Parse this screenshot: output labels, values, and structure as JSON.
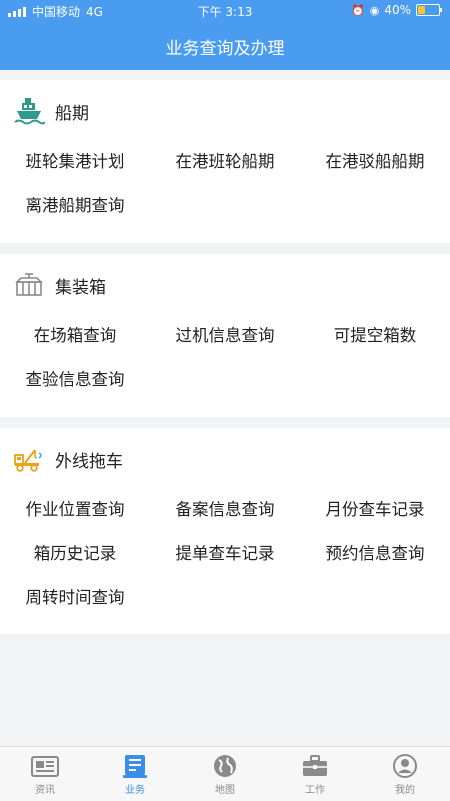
{
  "status_bar": {
    "carrier": "中国移动",
    "network": "4G",
    "time": "下午 3:13",
    "battery_text": "40%",
    "battery_level": 0.4,
    "battery_color": "#f7c43b"
  },
  "header": {
    "title": "业务查询及办理",
    "background": "#4a9cf0"
  },
  "sections": [
    {
      "title": "船期",
      "icon": "ship-icon",
      "items": [
        "班轮集港计划",
        "在港班轮船期",
        "在港驳船船期",
        "离港船期查询"
      ]
    },
    {
      "title": "集装箱",
      "icon": "container-icon",
      "items": [
        "在场箱查询",
        "过机信息查询",
        "可提空箱数",
        "查验信息查询"
      ]
    },
    {
      "title": "外线拖车",
      "icon": "tow-truck-icon",
      "items": [
        "作业位置查询",
        "备案信息查询",
        "月份查车记录",
        "箱历史记录",
        "提单查车记录",
        "预约信息查询",
        "周转时间查询"
      ]
    }
  ],
  "tabbar": {
    "active_color": "#3b8ee8",
    "tabs": [
      {
        "label": "资讯",
        "icon": "news-icon",
        "active": false
      },
      {
        "label": "业务",
        "icon": "business-icon",
        "active": true
      },
      {
        "label": "地图",
        "icon": "globe-icon",
        "active": false
      },
      {
        "label": "工作",
        "icon": "briefcase-icon",
        "active": false
      },
      {
        "label": "我的",
        "icon": "user-icon",
        "active": false
      }
    ]
  }
}
